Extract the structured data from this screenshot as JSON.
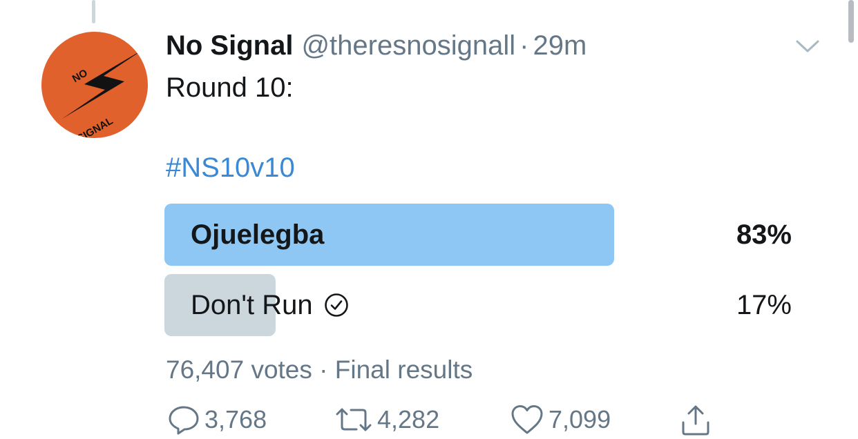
{
  "tweet": {
    "display_name": "No Signal",
    "handle": "@theresnosignall",
    "separator": "·",
    "time": "29m",
    "text_line1": "Round 10:",
    "hashtag": "#NS10v10"
  },
  "avatar": {
    "brand_color": "#e0612c",
    "logo_text_top": "NO",
    "logo_text_bottom": "SIGNAL"
  },
  "poll": {
    "options": [
      {
        "label": "Ojuelegba",
        "percent_label": "83%",
        "value": 0.83,
        "winner": true,
        "bar_color": "#8ec7f3"
      },
      {
        "label": "Don't Run",
        "percent_label": "17%",
        "value": 0.17,
        "winner": false,
        "voted": true,
        "bar_color": "#ccd6dd"
      }
    ],
    "votes": "76,407 votes",
    "separator": "·",
    "status": "Final results"
  },
  "actions": {
    "replies": "3,768",
    "retweets": "4,282",
    "likes": "7,099"
  },
  "icons": [
    "chevron-down-icon",
    "check-circle-icon",
    "reply-icon",
    "retweet-icon",
    "like-icon",
    "share-icon"
  ]
}
